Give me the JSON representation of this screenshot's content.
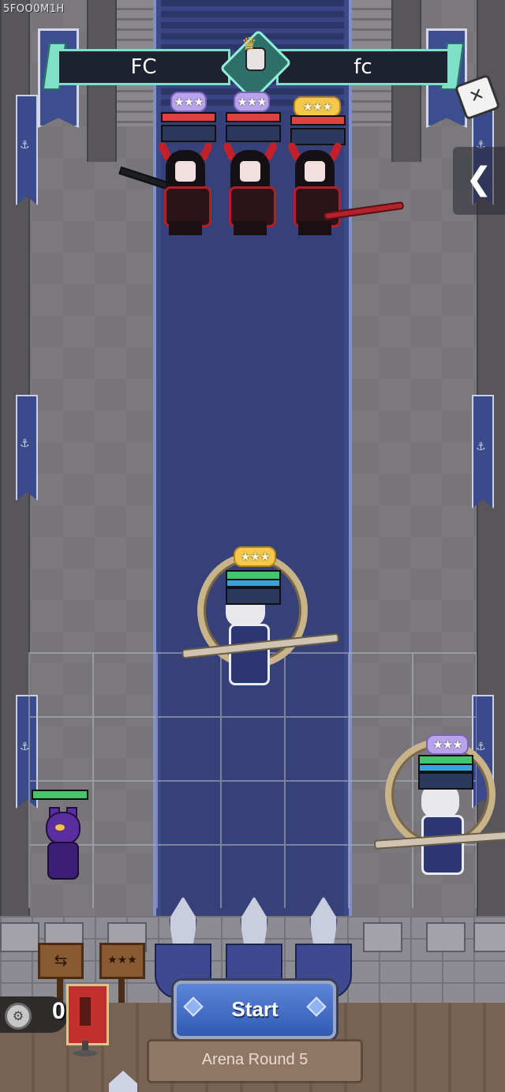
{
  "screen": {
    "player_id": "5FOO0M1H"
  },
  "header": {
    "team_left": "FC",
    "team_right": "fc"
  },
  "icons": {
    "dice": "dice-icon",
    "back": "chevron-left-icon",
    "swap": "swap-arrows-icon",
    "stars": "three-stars-icon",
    "coin": "coin-icon",
    "flag": "guild-flag-icon"
  },
  "controls": {
    "back_glyph": "❮",
    "swap_glyph": "⇆",
    "stars_glyph": "★★★",
    "dice_glyph": "✕"
  },
  "currency": {
    "coins": "0"
  },
  "actions": {
    "start_label": "Start"
  },
  "footer": {
    "round_label": "Arena Round 5"
  },
  "units": {
    "enemy": [
      {
        "name": "demon-1",
        "stars": "★★★",
        "star_color": "purple"
      },
      {
        "name": "demon-2",
        "stars": "★★★",
        "star_color": "purple"
      },
      {
        "name": "demon-3",
        "stars": "★★★",
        "star_color": "gold"
      }
    ],
    "player": [
      {
        "name": "hero-center",
        "stars": "★★★",
        "star_color": "gold"
      },
      {
        "name": "hero-right",
        "stars": "★★★",
        "star_color": "purple"
      }
    ]
  },
  "colors": {
    "accent": "#7ee0c6",
    "carpet": "#354178",
    "start_button": "#2f5bb4"
  }
}
